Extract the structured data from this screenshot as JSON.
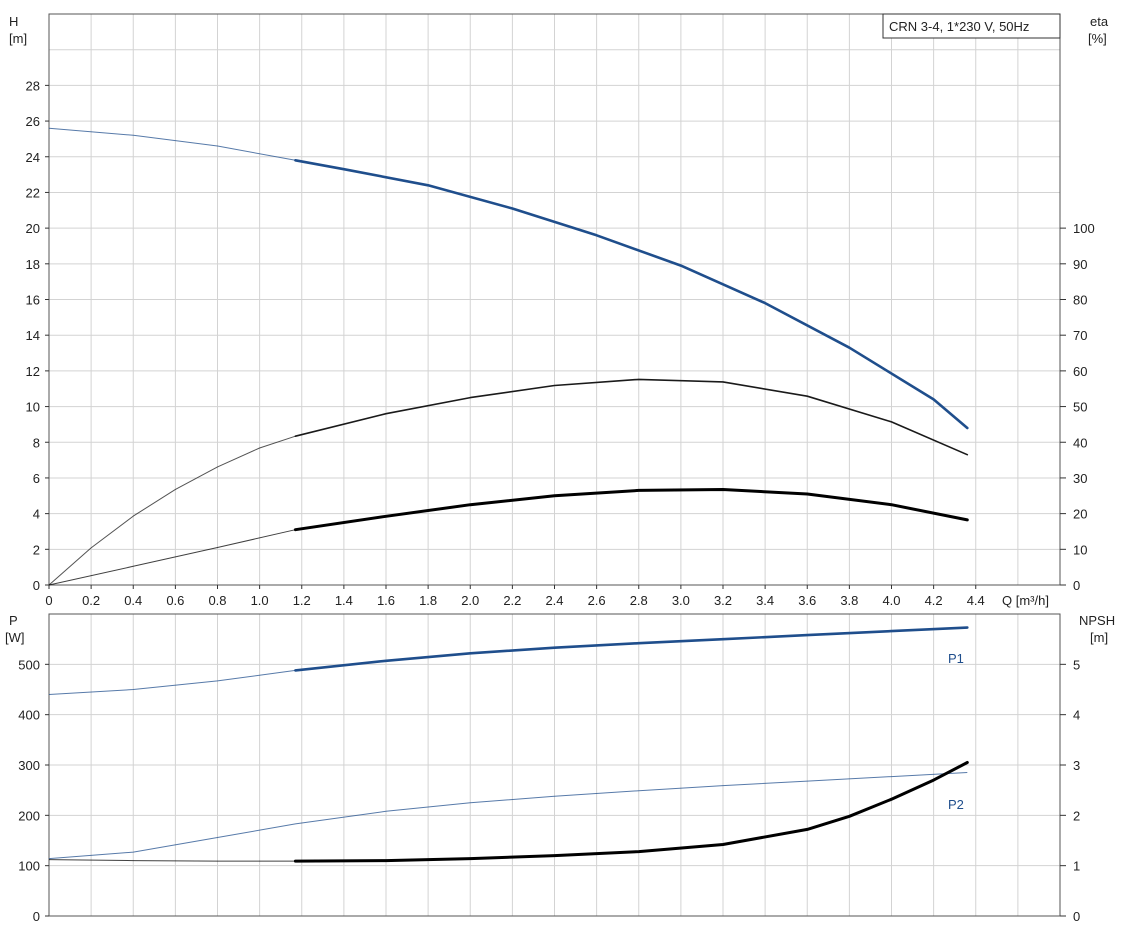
{
  "chart_data": [
    {
      "type": "line",
      "title": "CRN 3-4, 1*230 V, 50Hz",
      "x_axis": {
        "label": "Q [m³/h]",
        "ticks": [
          "0",
          "0.2",
          "0.4",
          "0.6",
          "0.8",
          "1.0",
          "1.2",
          "1.4",
          "1.6",
          "1.8",
          "2.0",
          "2.2",
          "2.4",
          "2.6",
          "2.8",
          "3.0",
          "3.2",
          "3.4",
          "3.6",
          "3.8",
          "4.0",
          "4.2",
          "4.4"
        ],
        "range": [
          0,
          4.8
        ]
      },
      "y_axis_left": {
        "label_line1": "H",
        "label_line2": "[m]",
        "ticks": [
          "0",
          "2",
          "4",
          "6",
          "8",
          "10",
          "12",
          "14",
          "16",
          "18",
          "20",
          "22",
          "24",
          "26",
          "28"
        ],
        "range": [
          0,
          32
        ]
      },
      "y_axis_right": {
        "label_line1": "eta",
        "label_line2": "[%]",
        "ticks": [
          "0",
          "10",
          "20",
          "30",
          "40",
          "50",
          "60",
          "70",
          "80",
          "90",
          "100"
        ],
        "range": [
          0,
          160
        ]
      },
      "grid": true,
      "series": [
        {
          "axis": "left",
          "color": "#1f4e8c",
          "thin_until_x": 1.17,
          "points": [
            [
              0,
              25.6
            ],
            [
              0.4,
              25.2
            ],
            [
              0.8,
              24.6
            ],
            [
              1.17,
              23.8
            ],
            [
              1.4,
              23.3
            ],
            [
              1.8,
              22.4
            ],
            [
              2.2,
              21.1
            ],
            [
              2.6,
              19.6
            ],
            [
              3.0,
              17.9
            ],
            [
              3.4,
              15.8
            ],
            [
              3.8,
              13.3
            ],
            [
              4.2,
              10.4
            ],
            [
              4.36,
              8.8
            ]
          ]
        },
        {
          "axis": "right",
          "color": "#1a1a1a",
          "thin_until_x": 1.17,
          "points": [
            [
              0,
              0
            ],
            [
              0.2,
              10.4
            ],
            [
              0.4,
              19.3
            ],
            [
              0.6,
              26.8
            ],
            [
              0.8,
              33.1
            ],
            [
              1.0,
              38.4
            ],
            [
              1.17,
              41.7
            ],
            [
              1.6,
              48.0
            ],
            [
              2.0,
              52.5
            ],
            [
              2.4,
              55.9
            ],
            [
              2.8,
              57.6
            ],
            [
              3.2,
              56.9
            ],
            [
              3.6,
              52.9
            ],
            [
              4.0,
              45.7
            ],
            [
              4.36,
              36.5
            ]
          ]
        },
        {
          "axis": "left",
          "color": "#000000",
          "thin_until_x": 1.17,
          "heavy": true,
          "points": [
            [
              0,
              0
            ],
            [
              0.4,
              1.05
            ],
            [
              0.8,
              2.1
            ],
            [
              1.17,
              3.1
            ],
            [
              1.6,
              3.85
            ],
            [
              2.0,
              4.5
            ],
            [
              2.4,
              5.0
            ],
            [
              2.8,
              5.3
            ],
            [
              3.2,
              5.35
            ],
            [
              3.6,
              5.1
            ],
            [
              4.0,
              4.5
            ],
            [
              4.36,
              3.65
            ]
          ]
        }
      ]
    },
    {
      "type": "line",
      "x_axis": {
        "range": [
          0,
          4.8
        ]
      },
      "y_axis_left": {
        "label_line1": "P",
        "label_line2": "[W]",
        "ticks": [
          "0",
          "100",
          "200",
          "300",
          "400",
          "500"
        ],
        "range": [
          0,
          600
        ]
      },
      "y_axis_right": {
        "label_line1": "NPSH",
        "label_line2": "[m]",
        "ticks": [
          "0",
          "1",
          "2",
          "3",
          "4",
          "5"
        ],
        "range": [
          0,
          6
        ]
      },
      "grid": true,
      "series": [
        {
          "name": "P1",
          "axis": "left",
          "color": "#1f4e8c",
          "thin_until_x": 1.17,
          "points": [
            [
              0,
              440
            ],
            [
              0.4,
              450
            ],
            [
              0.8,
              467
            ],
            [
              1.17,
              488
            ],
            [
              1.6,
              507
            ],
            [
              2.0,
              522
            ],
            [
              2.4,
              533
            ],
            [
              2.8,
              542
            ],
            [
              3.2,
              550
            ],
            [
              3.6,
              558
            ],
            [
              4.0,
              566
            ],
            [
              4.36,
              573
            ]
          ]
        },
        {
          "name": "P2",
          "axis": "left",
          "color": "#1f4e8c",
          "thin_until_x": 4.36,
          "points": [
            [
              0,
              114
            ],
            [
              0.4,
              127
            ],
            [
              0.8,
              156
            ],
            [
              1.17,
              183
            ],
            [
              1.6,
              208
            ],
            [
              2.0,
              225
            ],
            [
              2.4,
              238
            ],
            [
              2.8,
              249
            ],
            [
              3.2,
              259
            ],
            [
              3.6,
              268
            ],
            [
              4.0,
              277
            ],
            [
              4.36,
              285
            ]
          ]
        },
        {
          "axis": "right",
          "color": "#000000",
          "thin_until_x": 1.17,
          "heavy": true,
          "points": [
            [
              0,
              1.12
            ],
            [
              0.4,
              1.1
            ],
            [
              0.8,
              1.09
            ],
            [
              1.17,
              1.09
            ],
            [
              1.6,
              1.1
            ],
            [
              2.0,
              1.14
            ],
            [
              2.4,
              1.2
            ],
            [
              2.8,
              1.28
            ],
            [
              3.2,
              1.42
            ],
            [
              3.6,
              1.72
            ],
            [
              3.8,
              1.98
            ],
            [
              4.0,
              2.32
            ],
            [
              4.2,
              2.7
            ],
            [
              4.36,
              3.05
            ]
          ]
        }
      ]
    }
  ]
}
